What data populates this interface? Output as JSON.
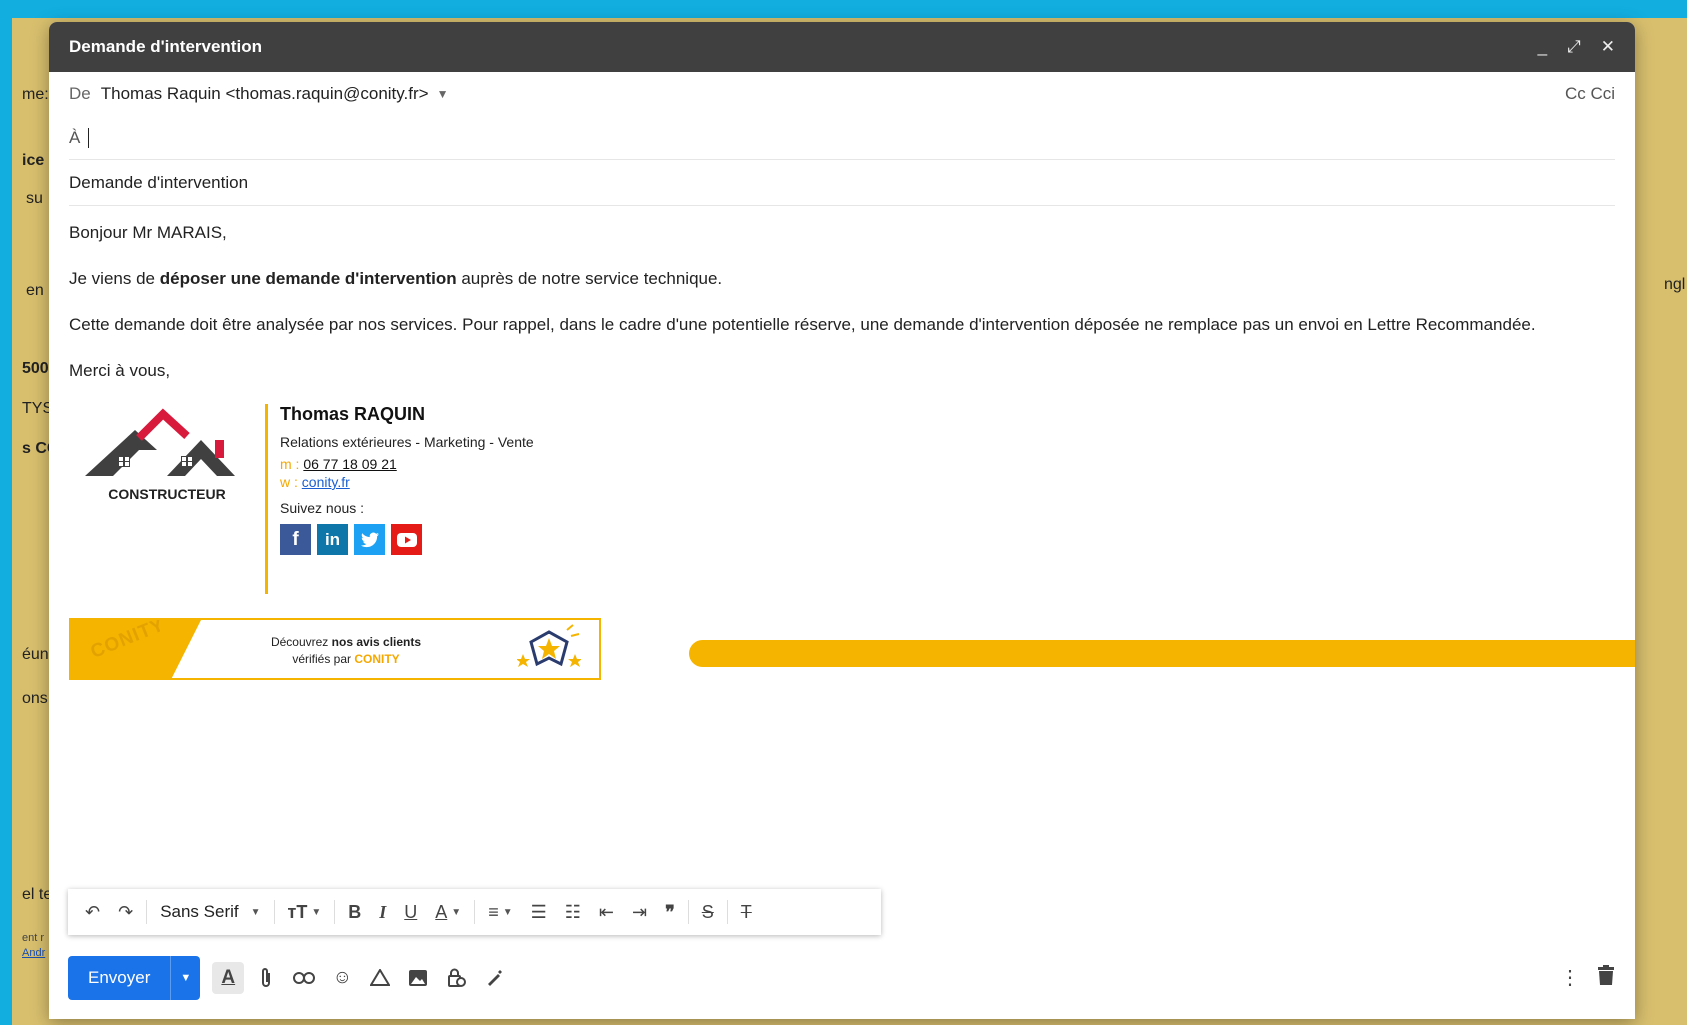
{
  "window": {
    "title": "Demande d'intervention",
    "controls": [
      "_",
      "⤢",
      "✕"
    ]
  },
  "from": {
    "label": "De",
    "value": "Thomas Raquin <thomas.raquin@conity.fr>",
    "cc_label": "Cc Cci"
  },
  "to": {
    "label": "À"
  },
  "subject": "Demande d'intervention",
  "body": {
    "greeting": "Bonjour Mr MARAIS,",
    "line1_before": "Je viens de ",
    "line1_bold": "déposer une demande d'intervention",
    "line1_after": " auprès de notre service technique.",
    "line2": "Cette demande doit être analysée par nos services. Pour rappel, dans le cadre d'une potentielle réserve, une demande d'intervention déposée ne remplace pas un envoi en Lettre Recommandée.",
    "closing": "Merci à vous,"
  },
  "signature": {
    "logo_text": "CONSTRUCTEUR",
    "name": "Thomas RAQUIN",
    "role": "Relations extérieures - Marketing - Vente",
    "phone_label": "m : ",
    "phone": "06 77 18 09 21",
    "web_label": "w : ",
    "web": "conity.fr",
    "follow": "Suivez nous :",
    "socials": [
      "facebook",
      "linkedin",
      "twitter",
      "youtube"
    ]
  },
  "banner": {
    "seal_text": "CONITY",
    "text_before": "Découvrez ",
    "text_bold": "nos avis clients",
    "text_line2": "vérifiés par ",
    "brand": "CONITY"
  },
  "format_toolbar": {
    "font": "Sans Serif",
    "icons": [
      "undo-icon",
      "redo-icon",
      "font-select",
      "text-size-icon",
      "bold-icon",
      "italic-icon",
      "underline-icon",
      "text-color-icon",
      "align-icon",
      "numbered-list-icon",
      "bulleted-list-icon",
      "indent-less-icon",
      "indent-more-icon",
      "quote-icon",
      "strikethrough-icon",
      "remove-formatting-icon"
    ]
  },
  "actions": {
    "send_label": "Envoyer",
    "icons": [
      "formatting-icon",
      "attach-icon",
      "link-icon",
      "emoji-icon",
      "drive-icon",
      "photo-icon",
      "confidential-icon",
      "signature-icon",
      "more-options-icon",
      "trash-icon"
    ]
  },
  "background": {
    "fragments": [
      "me:",
      "ice",
      "su",
      "en",
      "500",
      "TYS",
      "s CC",
      "éun",
      "ons",
      "el te",
      "ent r",
      "Andr",
      "ngl"
    ]
  },
  "colors": {
    "accent": "#1a73e8",
    "brand_yellow": "#f5b400",
    "titlebar": "#404040",
    "frame": "#12aee0"
  }
}
